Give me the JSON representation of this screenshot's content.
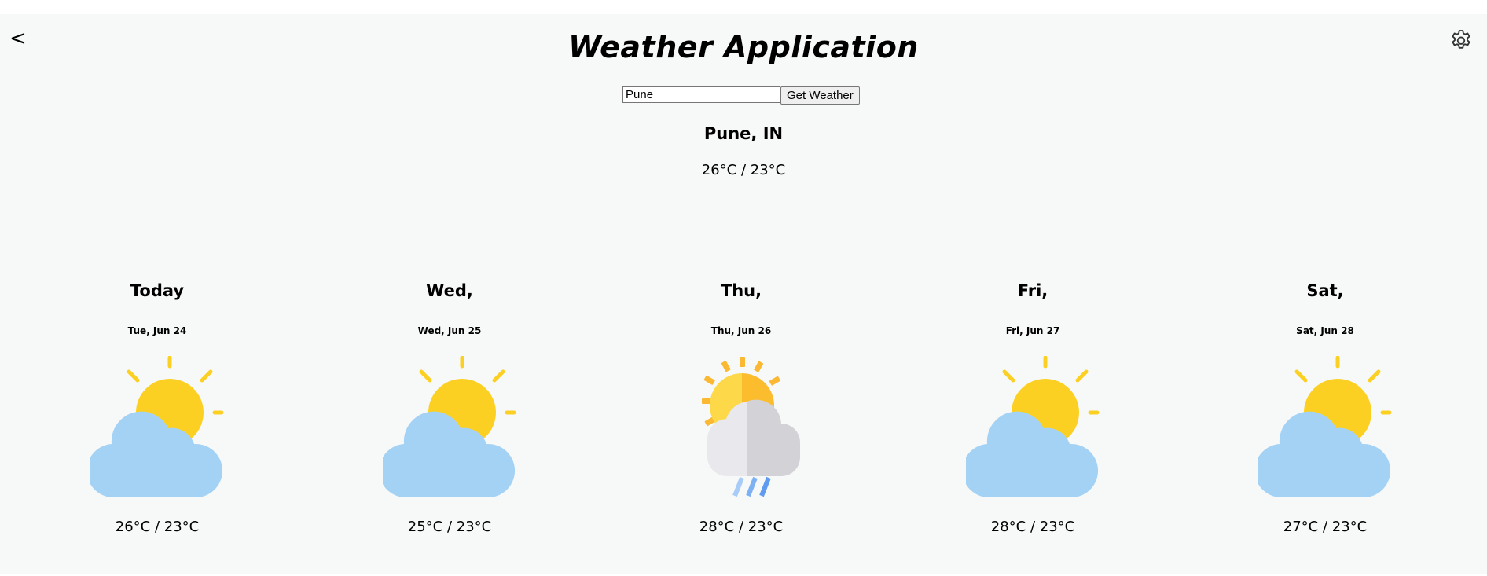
{
  "header": {
    "back_label": "<",
    "title": "Weather Application",
    "settings_icon": "gear-icon"
  },
  "search": {
    "value": "Pune",
    "button_label": "Get Weather"
  },
  "current": {
    "location": "Pune, IN",
    "temp_range": "26°C / 23°C"
  },
  "forecast": [
    {
      "day": "Today",
      "date": "Tue, Jun 24",
      "icon": "partly-cloudy-icon",
      "temp_range": "26°C / 23°C"
    },
    {
      "day": "Wed,",
      "date": "Wed, Jun 25",
      "icon": "partly-cloudy-icon",
      "temp_range": "25°C / 23°C"
    },
    {
      "day": "Thu,",
      "date": "Thu, Jun 26",
      "icon": "rain-shower-icon",
      "temp_range": "28°C / 23°C"
    },
    {
      "day": "Fri,",
      "date": "Fri, Jun 27",
      "icon": "partly-cloudy-icon",
      "temp_range": "28°C / 23°C"
    },
    {
      "day": "Sat,",
      "date": "Sat, Jun 28",
      "icon": "partly-cloudy-icon",
      "temp_range": "27°C / 23°C"
    }
  ],
  "colors": {
    "sun": "#fcd022",
    "cloud": "#a4d2f5",
    "background": "#f7f8f8"
  }
}
